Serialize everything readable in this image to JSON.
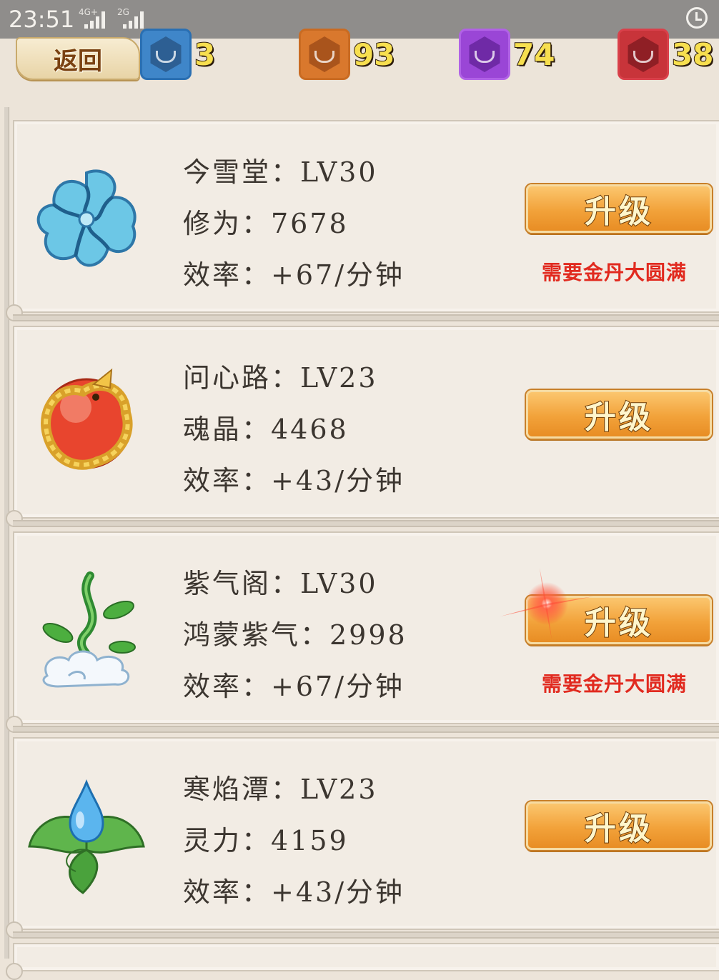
{
  "status_bar": {
    "time": "23:51",
    "network_1": "4G+",
    "network_2": "2G"
  },
  "header": {
    "back_label": "返回",
    "resources": [
      {
        "icon": "blue-gem-icon",
        "value": "3",
        "color": "#3f86c9"
      },
      {
        "icon": "orange-gem-icon",
        "value": "93",
        "color": "#d9782d"
      },
      {
        "icon": "purple-gem-icon",
        "value": "74",
        "color": "#9a46d6"
      },
      {
        "icon": "red-gem-icon",
        "value": "38",
        "color": "#c8343a"
      }
    ]
  },
  "buildings": [
    {
      "icon": "blue-cloud-knot-icon",
      "name_line": "今雪堂：LV30",
      "stat_line": "修为：7678",
      "rate_line": "效率：+67/分钟",
      "button": "升级",
      "note": "需要金丹大圆满"
    },
    {
      "icon": "golden-dragon-orb-icon",
      "name_line": "问心路：LV23",
      "stat_line": "魂晶：4468",
      "rate_line": "效率：+43/分钟",
      "button": "升级",
      "note": ""
    },
    {
      "icon": "green-vine-cloud-icon",
      "name_line": "紫气阁：LV30",
      "stat_line": "鸿蒙紫气：2998",
      "rate_line": "效率：+67/分钟",
      "button": "升级",
      "note": "需要金丹大圆满"
    },
    {
      "icon": "water-drop-leaf-icon",
      "name_line": "寒焰潭：LV23",
      "stat_line": "灵力：4159",
      "rate_line": "效率：+43/分钟",
      "button": "升级",
      "note": ""
    }
  ]
}
